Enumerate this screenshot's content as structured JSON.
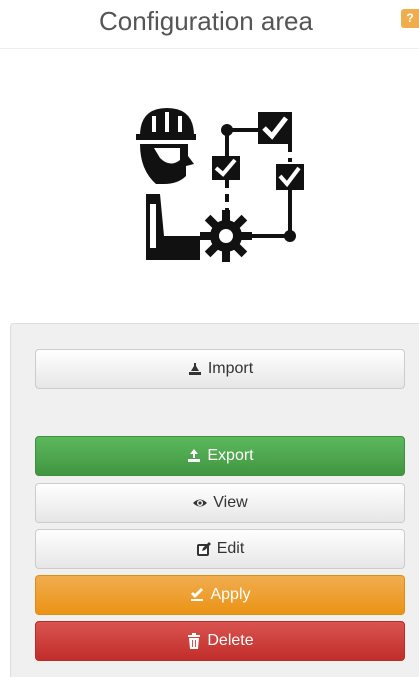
{
  "header": {
    "title": "Configuration area",
    "help_badge": "?"
  },
  "illustration": {
    "icon": "engineer-configuration-checklist-icon"
  },
  "actions": {
    "import_label": "Import",
    "export_label": "Export",
    "view_label": "View",
    "edit_label": "Edit",
    "apply_label": "Apply",
    "delete_label": "Delete"
  },
  "colors": {
    "success": "#5cb85c",
    "warning": "#f0ad4e",
    "danger": "#d9534f",
    "default": "#f5f5f5"
  }
}
